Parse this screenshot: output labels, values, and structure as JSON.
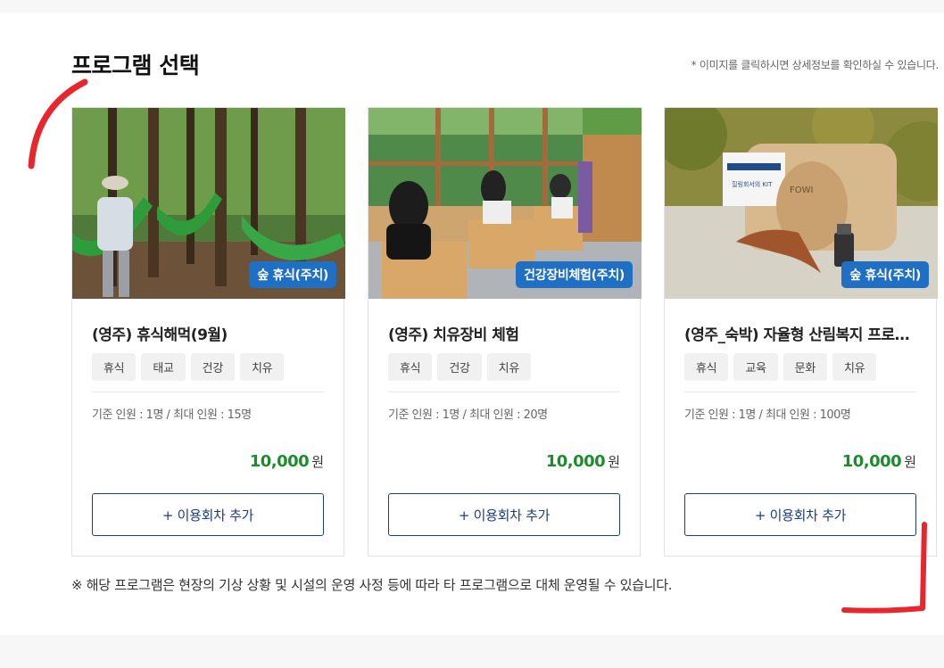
{
  "header": {
    "title": "프로그램 선택",
    "notice": "* 이미지를 클릭하시면 상세정보를 확인하실 수 있습니다."
  },
  "cards": [
    {
      "badge": "숲 휴식(주치)",
      "title": "(영주) 휴식해먹(9월)",
      "tags": [
        "휴식",
        "태교",
        "건강",
        "치유"
      ],
      "capacity": "기준 인원 : 1명 / 최대 인원 : 15명",
      "price": "10,000",
      "price_unit": "원",
      "button": "+ 이용회차 추가"
    },
    {
      "badge": "건강장비체험(주치)",
      "title": "(영주) 치유장비 체험",
      "tags": [
        "휴식",
        "건강",
        "치유"
      ],
      "capacity": "기준 인원 : 1명 / 최대 인원 : 20명",
      "price": "10,000",
      "price_unit": "원",
      "button": "+ 이용회차 추가"
    },
    {
      "badge": "숲 휴식(주치)",
      "title": "(영주_숙박) 자율형 산림복지 프로그램",
      "tags": [
        "휴식",
        "교육",
        "문화",
        "치유"
      ],
      "capacity": "기준 인원 : 1명 / 최대 인원 : 100명",
      "price": "10,000",
      "price_unit": "원",
      "button": "+ 이용회차 추가"
    }
  ],
  "footer_note": "※ 해당 프로그램은 현장의 기상 상황 및 시설의 운영 사정 등에 따라 타 프로그램으로 대체 운영될 수 있습니다.",
  "colors": {
    "badge": "#1f6fc5",
    "price": "#1e8c2e",
    "button_border": "#1d3c86",
    "annotation": "#e8262e"
  },
  "kit_label": "힐링회서의 KIT",
  "brand_label": "FOWI"
}
